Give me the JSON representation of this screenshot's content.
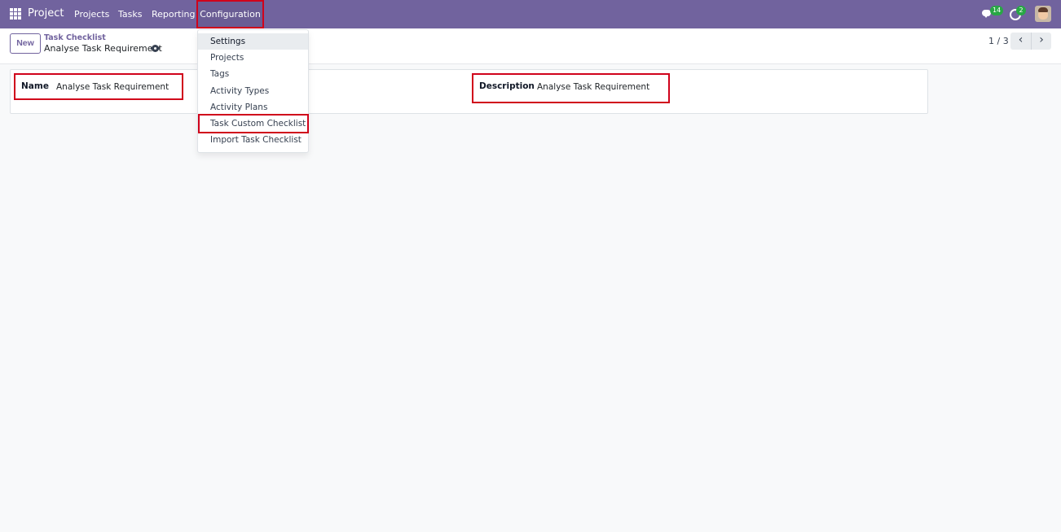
{
  "navbar": {
    "app_name": "Project",
    "menu": [
      "Projects",
      "Tasks",
      "Reporting",
      "Configuration"
    ],
    "messages_badge": "14",
    "activities_badge": "2",
    "background": "#71639e"
  },
  "control_panel": {
    "new_label": "New",
    "breadcrumb_parent": "Task Checklist",
    "breadcrumb_current": "Analyse Task Requirement",
    "pager": "1 / 3",
    "prev_symbol": "‹",
    "next_symbol": "›"
  },
  "form": {
    "name_label": "Name",
    "name_value": "Analyse Task Requirement",
    "description_label": "Description",
    "description_value": "Analyse Task Requirement"
  },
  "dropdown": {
    "items": [
      "Settings",
      "Projects",
      "Tags",
      "Activity Types",
      "Activity Plans",
      "Task Custom Checklist",
      "Import Task Checklist"
    ]
  },
  "colors": {
    "highlight": "#d0021b",
    "accent": "#71639e",
    "badge": "#28a745"
  }
}
